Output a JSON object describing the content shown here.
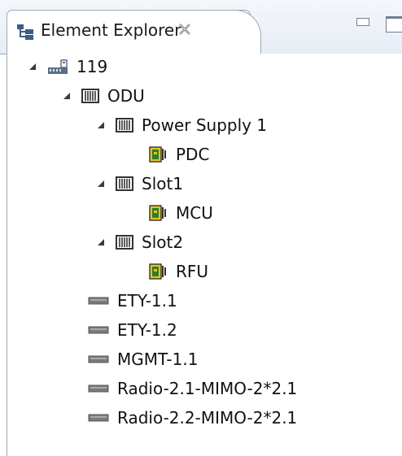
{
  "view": {
    "title": "Element Explorer",
    "close_glyph": "✕"
  },
  "tree": {
    "root": {
      "label": "119",
      "icon": "network-element-icon"
    },
    "odu": {
      "label": "ODU",
      "icon": "rack-icon"
    },
    "power_supply": {
      "label": "Power Supply 1",
      "icon": "rack-icon"
    },
    "pdc": {
      "label": "PDC",
      "icon": "card-module-icon"
    },
    "slot1": {
      "label": "Slot1",
      "icon": "rack-icon"
    },
    "mcu": {
      "label": "MCU",
      "icon": "card-module-icon"
    },
    "slot2": {
      "label": "Slot2",
      "icon": "rack-icon"
    },
    "rfu": {
      "label": "RFU",
      "icon": "card-module-icon"
    },
    "ports": [
      {
        "label": "ETY-1.1",
        "icon": "port-icon"
      },
      {
        "label": "ETY-1.2",
        "icon": "port-icon"
      },
      {
        "label": "MGMT-1.1",
        "icon": "port-icon"
      },
      {
        "label": "Radio-2.1-MIMO-2*2.1",
        "icon": "port-icon"
      },
      {
        "label": "Radio-2.2-MIMO-2*2.1",
        "icon": "port-icon"
      }
    ]
  },
  "colors": {
    "border": "#9aaabb",
    "tab_gradient_top": "#f4f7fb",
    "tab_gradient_bottom": "#e7edf5",
    "module_green": "#2f7d2f",
    "module_yellow": "#e5c41a",
    "port_grey": "#7a7a7a"
  }
}
